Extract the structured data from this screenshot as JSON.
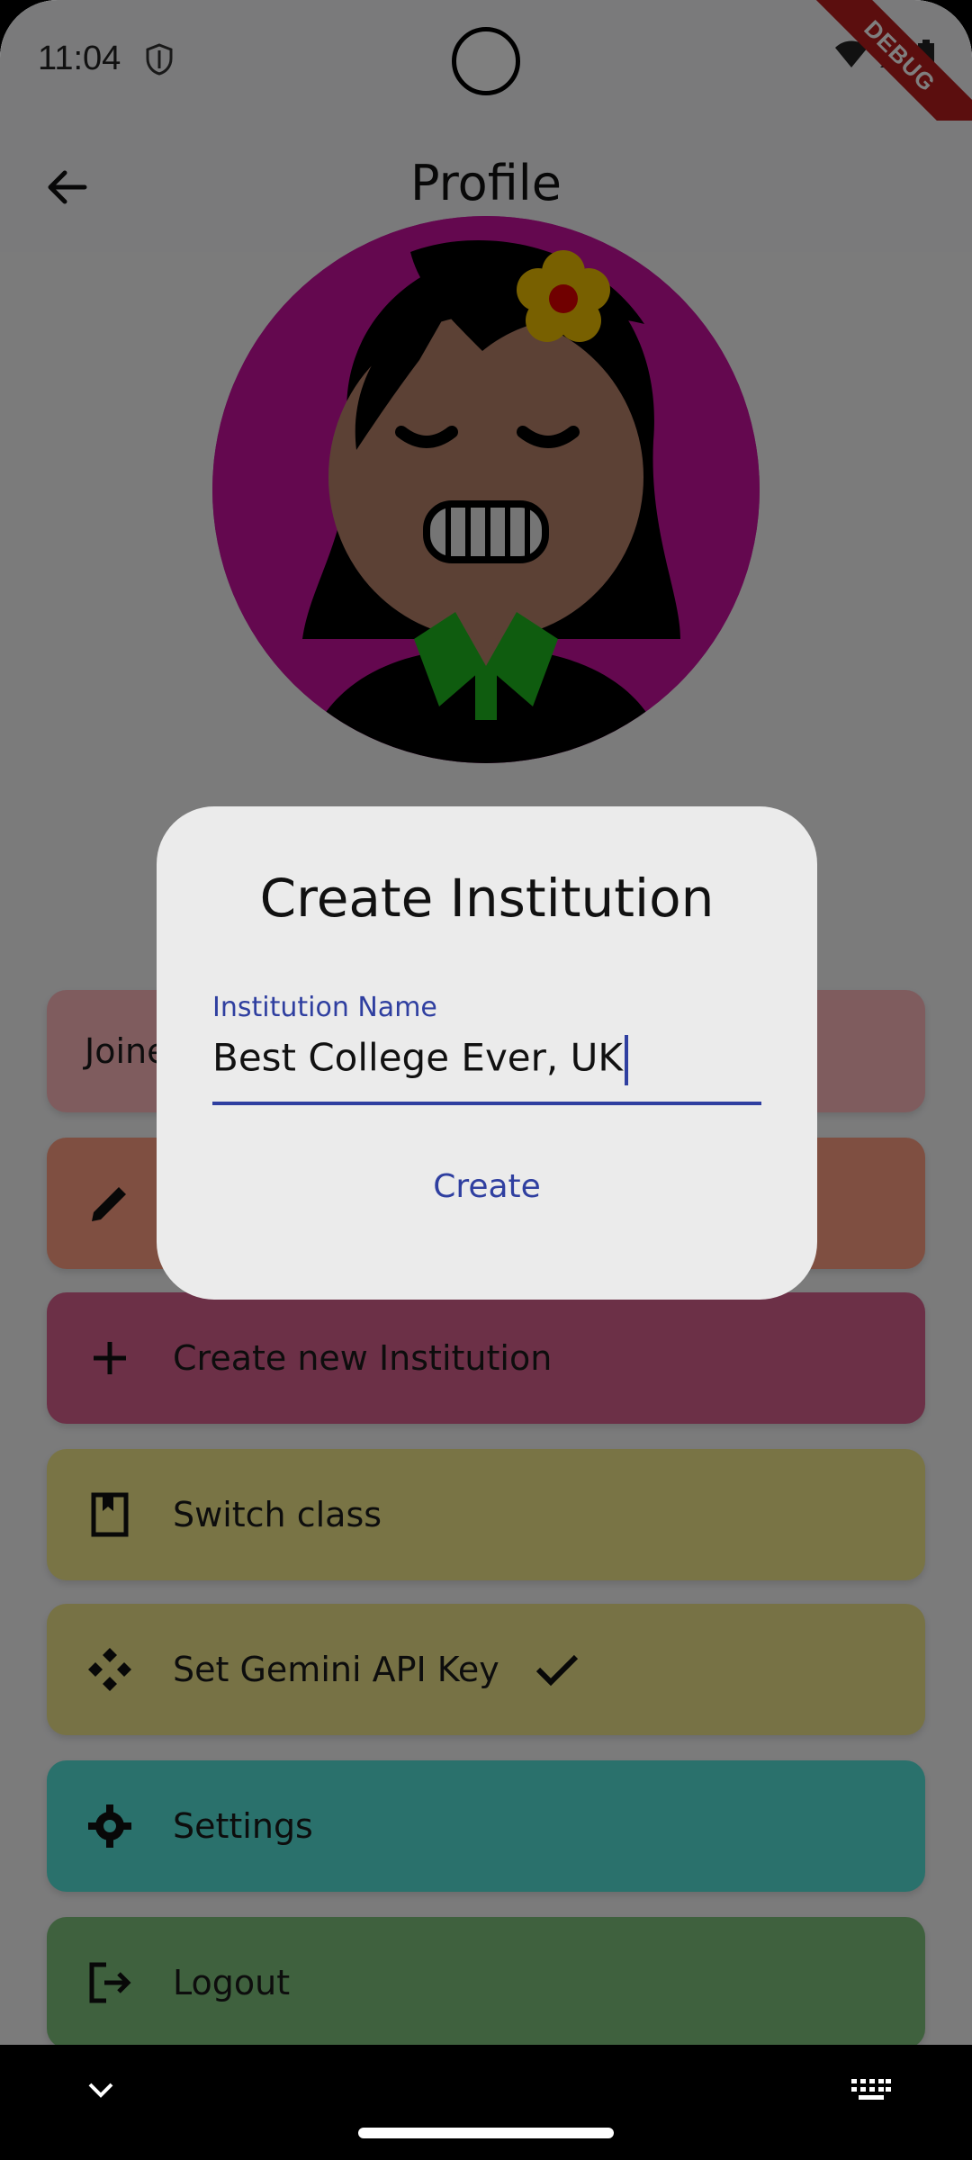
{
  "status_bar": {
    "time": "11:04",
    "debug_label": "DEBUG"
  },
  "app_bar": {
    "title": "Profile"
  },
  "menu": {
    "joined_label": "Joined",
    "items": [
      {
        "label": "Create new Institution",
        "icon": "plus-icon"
      },
      {
        "label": "Switch class",
        "icon": "bookmark-icon"
      },
      {
        "label": "Set Gemini API Key",
        "icon": "gemini-icon",
        "trailing_icon": "check-icon"
      },
      {
        "label": "Settings",
        "icon": "gear-icon"
      },
      {
        "label": "Logout",
        "icon": "logout-icon"
      }
    ],
    "edit_icon": "pencil-icon"
  },
  "dialog": {
    "title": "Create Institution",
    "field_label": "Institution Name",
    "field_value": "Best College Ever, UK",
    "create_label": "Create"
  },
  "colors": {
    "accent": "#2f3fa0",
    "avatar_bg": "#c9119f",
    "joined_bg": "#ffb8bd",
    "edit_bg": "#ff9f83",
    "create_bg": "#d9608e",
    "switch_bg": "#f2e98a",
    "gemini_bg": "#efe58a",
    "settings_bg": "#54e3d8",
    "logout_bg": "#7fc27c"
  }
}
